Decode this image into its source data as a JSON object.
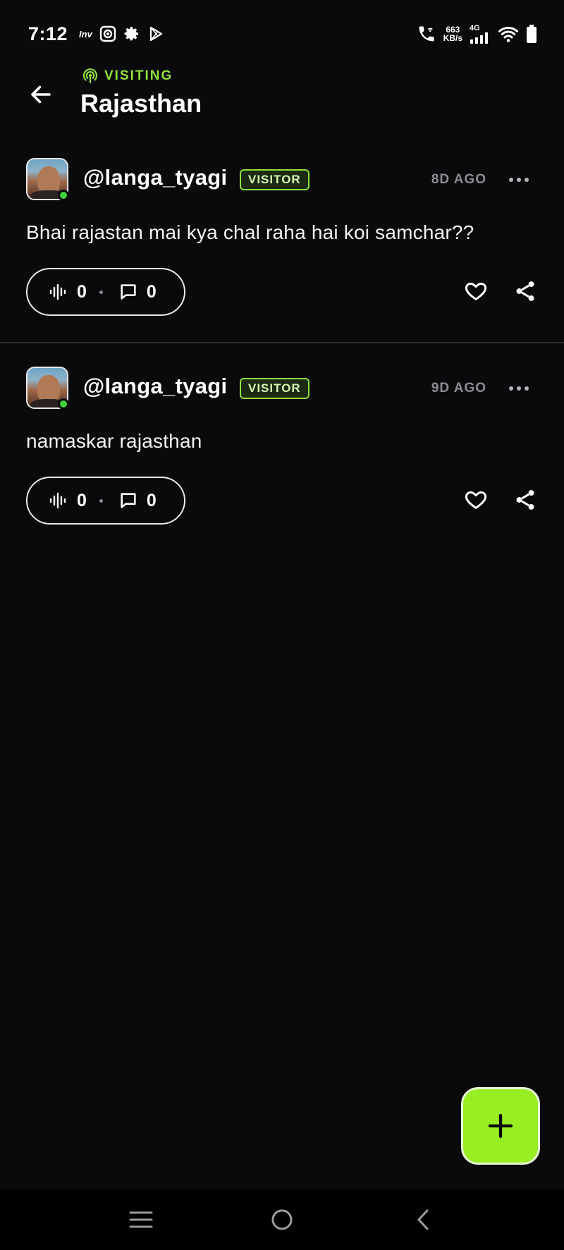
{
  "status_bar": {
    "time": "7:12",
    "carrier_tag": "Inv",
    "net_speed_value": "663",
    "net_speed_unit": "KB/s",
    "network_type": "4G"
  },
  "header": {
    "section_label": "VISITING",
    "title": "Rajasthan"
  },
  "posts": [
    {
      "username": "@langa_tyagi",
      "badge": "VISITOR",
      "time_ago": "8D AGO",
      "text": "Bhai rajastan mai kya chal raha hai koi samchar??",
      "audio_count": "0",
      "comment_count": "0"
    },
    {
      "username": "@langa_tyagi",
      "badge": "VISITOR",
      "time_ago": "9D AGO",
      "text": "namaskar rajasthan",
      "audio_count": "0",
      "comment_count": "0"
    }
  ],
  "icons": {
    "back": "arrow-left-icon",
    "visiting": "broadcast-icon",
    "more": "more-horizontal-icon",
    "audio": "waveform-icon",
    "comment": "comment-icon",
    "like": "heart-icon",
    "share": "share-icon",
    "fab": "plus-icon"
  },
  "colors": {
    "background": "#0a0a0c",
    "accent": "#97ee22",
    "visiting_label": "#8fe03a",
    "online": "#3fd23c",
    "muted": "#8c8c92"
  }
}
